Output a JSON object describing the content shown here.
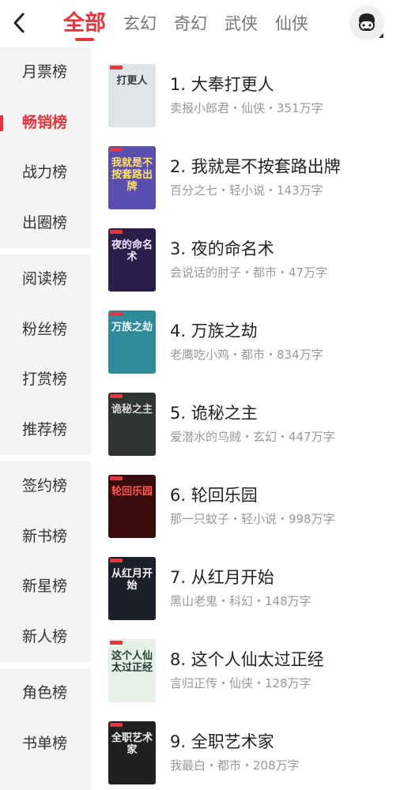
{
  "header": {
    "tabs": [
      {
        "label": "全部",
        "active": true
      },
      {
        "label": "玄幻",
        "active": false
      },
      {
        "label": "奇幻",
        "active": false
      },
      {
        "label": "武侠",
        "active": false
      },
      {
        "label": "仙侠",
        "active": false
      }
    ]
  },
  "sidebar": {
    "groups": [
      [
        "月票榜",
        "畅销榜",
        "战力榜",
        "出圈榜"
      ],
      [
        "阅读榜",
        "粉丝榜",
        "打赏榜",
        "推荐榜"
      ],
      [
        "签约榜",
        "新书榜",
        "新星榜",
        "新人榜"
      ],
      [
        "角色榜",
        "书单榜"
      ]
    ],
    "active": "畅销榜"
  },
  "books": [
    {
      "title": "1. 大奉打更人",
      "meta": "卖报小郎君・仙侠・351万字",
      "cover_text": "打更人",
      "cover_bg": "#dfe4e8",
      "cover_fg": "#3a3a3a"
    },
    {
      "title": "2. 我就是不按套路出牌",
      "meta": "百分之七・轻小说・143万字",
      "cover_text": "我就是不按套路出牌",
      "cover_bg": "#5a4fb0",
      "cover_fg": "#ffe066"
    },
    {
      "title": "3. 夜的命名术",
      "meta": "会说话的肘子・都市・47万字",
      "cover_text": "夜的命名术",
      "cover_bg": "#2c1e4a",
      "cover_fg": "#f2e3ff"
    },
    {
      "title": "4. 万族之劫",
      "meta": "老鹰吃小鸡・都市・834万字",
      "cover_text": "万族之劫",
      "cover_bg": "#2f8a9a",
      "cover_fg": "#e8fbff"
    },
    {
      "title": "5. 诡秘之主",
      "meta": "爱潜水的乌贼・玄幻・447万字",
      "cover_text": "诡秘之主",
      "cover_bg": "#2f3432",
      "cover_fg": "#d9d9d9"
    },
    {
      "title": "6. 轮回乐园",
      "meta": "那一只蚊子・轻小说・998万字",
      "cover_text": "轮回乐园",
      "cover_bg": "#3a0b0d",
      "cover_fg": "#ff5a4f"
    },
    {
      "title": "7. 从红月开始",
      "meta": "黑山老鬼・科幻・148万字",
      "cover_text": "从红月开始",
      "cover_bg": "#1d1f2a",
      "cover_fg": "#f4f4f4"
    },
    {
      "title": "8. 这个人仙太过正经",
      "meta": "言归正传・仙侠・128万字",
      "cover_text": "这个人仙太过正经",
      "cover_bg": "#e7efe9",
      "cover_fg": "#1f3b30"
    },
    {
      "title": "9. 全职艺术家",
      "meta": "我最白・都市・208万字",
      "cover_text": "全职艺术家",
      "cover_bg": "#202020",
      "cover_fg": "#f0f0f0"
    }
  ],
  "colors": {
    "accent": "#e8343d",
    "sidebar_bg": "#f4f4f4",
    "meta_text": "#999999"
  },
  "icons": {
    "back": "chevron-left-icon",
    "avatar": "user-avatar-icon"
  }
}
